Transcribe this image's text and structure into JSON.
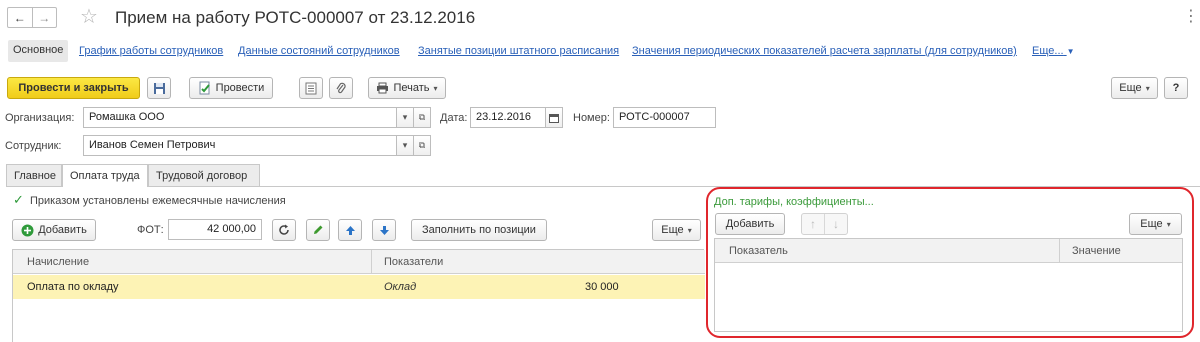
{
  "titlebar": {
    "back": "←",
    "forward": "→",
    "star": "☆",
    "title": "Прием на работу РОТС-000007 от 23.12.2016",
    "more": "⋮"
  },
  "nav": {
    "items": [
      "Основное",
      "График работы сотрудников",
      "Данные состояний сотрудников",
      "Занятые позиции штатного расписания",
      "Значения периодических показателей расчета зарплаты (для сотрудников)",
      "Еще..."
    ],
    "more_caret": "▼"
  },
  "toolbar": {
    "post_close": "Провести и закрыть",
    "post": "Провести",
    "print": "Печать",
    "more": "Еще",
    "help": "?",
    "dropdown": "▾"
  },
  "form": {
    "org_label": "Организация:",
    "org_value": "Ромашка ООО",
    "date_label": "Дата:",
    "date_value": "23.12.2016",
    "number_label": "Номер:",
    "number_value": "РОТС-000007",
    "employee_label": "Сотрудник:",
    "employee_value": "Иванов Семен Петрович",
    "select_glyph": "▾",
    "open_glyph": "⧉"
  },
  "tabs": [
    "Главное",
    "Оплата труда",
    "Трудовой договор"
  ],
  "payroll": {
    "checkbox_label": "Приказом установлены ежемесячные начисления",
    "checked": true,
    "add": "Добавить",
    "fot_label": "ФОТ:",
    "fot_value": "42 000,00",
    "fill": "Заполнить по позиции",
    "more": "Еще",
    "columns": [
      "Начисление",
      "Показатели"
    ],
    "rows": [
      {
        "accrual": "Оплата по окладу",
        "indicator": "Оклад",
        "value": "30 000"
      }
    ]
  },
  "extras": {
    "title": "Доп. тарифы, коэффициенты...",
    "add": "Добавить",
    "up": "↑",
    "down": "↓",
    "more": "Еще",
    "columns": [
      "Показатель",
      "Значение"
    ]
  },
  "colors": {
    "accent_yellow": "#f5d52a",
    "link_blue": "#2a60b8",
    "highlight_red": "#e0262c",
    "row_selected": "#fdf3b5",
    "green_title": "#3a9a3a"
  }
}
